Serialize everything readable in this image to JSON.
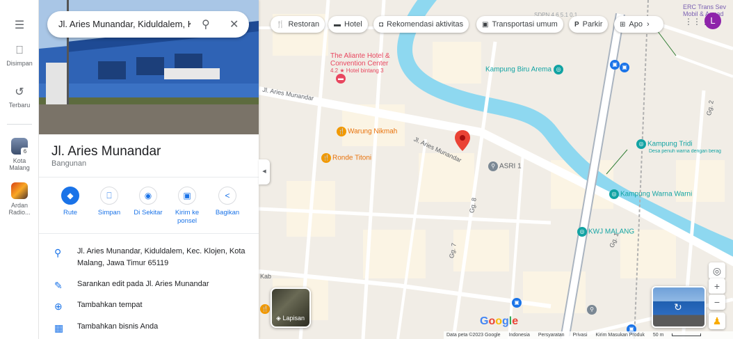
{
  "rail": {
    "menu_icon": "menu-icon",
    "saved_label": "Disimpan",
    "recent_label": "Terbaru",
    "recent_items": [
      {
        "label_line1": "Kota",
        "label_line2": "Malang",
        "badge": "6"
      },
      {
        "label_line1": "Ardan",
        "label_line2": "Radio..."
      }
    ]
  },
  "search": {
    "value": "Jl. Aries Munandar, Kiduldalem, Kec. Klojen, Kota Malang, Jawa Timur 65119"
  },
  "place": {
    "title": "Jl. Aries Munandar",
    "category": "Bangunan"
  },
  "actions": [
    {
      "label": "Rute"
    },
    {
      "label": "Simpan"
    },
    {
      "label": "Di Sekitar"
    },
    {
      "label": "Kirim ke ponsel"
    },
    {
      "label": "Bagikan"
    }
  ],
  "info": {
    "address": "Jl. Aries Munandar, Kiduldalem, Kec. Klojen, Kota Malang, Jawa Timur 65119",
    "suggest_edit": "Sarankan edit pada Jl. Aries Munandar",
    "add_place": "Tambahkan tempat",
    "add_business": "Tambahkan bisnis Anda"
  },
  "chips": [
    {
      "label": "Restoran"
    },
    {
      "label": "Hotel"
    },
    {
      "label": "Rekomendasi aktivitas"
    },
    {
      "label": "Transportasi umum"
    },
    {
      "label": "Parkir"
    },
    {
      "label": "Apo"
    }
  ],
  "user_initial": "L",
  "map": {
    "pois": {
      "hotel_name_1": "The Aliante Hotel &",
      "hotel_name_2": "Convention Center",
      "hotel_rating": "4.2 ★ Hotel bintang 3",
      "warung": "Warung Nikmah",
      "ronde": "Ronde Titoni",
      "asri": "ASRI 1",
      "kampung_biru": "Kampung Biru Arema",
      "kampung_tridi": "Kampung Tridi",
      "kampung_tridi_sub": "Desa penuh warna dengan berag",
      "kampung_warni": "Kampung Warna Warni",
      "kwj": "KWJ MALANG",
      "erc_1": "ERC Trans Sev",
      "erc_2": "Mobil & Armad",
      "sdn": "SDPN 4.6 5.1 0.1"
    },
    "streets": {
      "aries_1": "Jl. Aries Munandar",
      "aries_2": "Jl. Aries Munandar",
      "gg1": "Gg. 1",
      "gg7": "Gg. 7",
      "gg8": "Gg. 8",
      "gg2": "Gg. 2",
      "kab": "Kab"
    },
    "layer_label": "Lapisan",
    "google": "Google",
    "footer": {
      "data": "Data peta ©2023 Google",
      "country": "Indonesia",
      "terms": "Persyaratan",
      "privacy": "Privasi",
      "feedback": "Kirim Masukan Produk",
      "scale": "50 m"
    }
  }
}
